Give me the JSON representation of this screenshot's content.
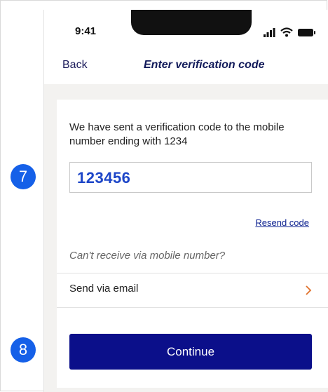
{
  "status_bar": {
    "time": "9:41"
  },
  "nav": {
    "back_label": "Back",
    "title": "Enter verification code"
  },
  "verification": {
    "message": "We have sent a verification code to the mobile number ending with 1234",
    "code_value": "123456",
    "resend_label": "Resend code",
    "cant_receive_label": "Can't receive via mobile number?",
    "send_email_label": "Send via email",
    "continue_label": "Continue"
  },
  "annotations": {
    "step_7": "7",
    "step_8": "8"
  },
  "colors": {
    "primary_button": "#0b0f8a",
    "code_text": "#1d46c8",
    "chevron": "#e0702a",
    "step_badge": "#1560e8"
  }
}
